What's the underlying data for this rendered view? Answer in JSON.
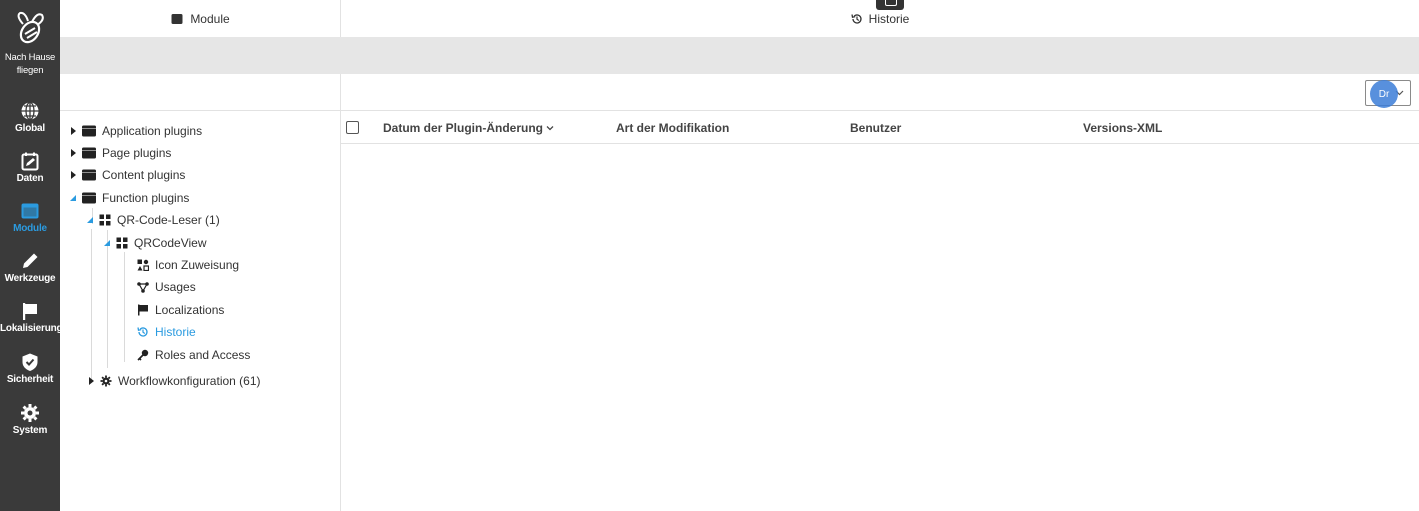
{
  "nav": {
    "home_label_line1": "Nach Hause",
    "home_label_line2": "fliegen",
    "items": [
      {
        "label": "Global",
        "icon": "globe-icon"
      },
      {
        "label": "Daten",
        "icon": "calendar-edit-icon"
      },
      {
        "label": "Module",
        "icon": "module-icon",
        "active": true
      },
      {
        "label": "Werkzeuge",
        "icon": "pencil-icon"
      },
      {
        "label": "Lokalisierung",
        "icon": "flag-icon"
      },
      {
        "label": "Sicherheit",
        "icon": "shield-check-icon"
      },
      {
        "label": "System",
        "icon": "gear-icon"
      }
    ],
    "active_color": "#2b9be0",
    "background": "#3a3a3a"
  },
  "left_panel": {
    "title": "Module",
    "tree": [
      {
        "label": "Application plugins",
        "expanded": false
      },
      {
        "label": "Page plugins",
        "expanded": false
      },
      {
        "label": "Content plugins",
        "expanded": false
      },
      {
        "label": "Function plugins",
        "expanded": true
      },
      {
        "label": "QR-Code-Leser (1)",
        "expanded": true
      },
      {
        "label": "QRCodeView",
        "expanded": true
      },
      {
        "label": "Icon Zuweisung"
      },
      {
        "label": "Usages"
      },
      {
        "label": "Localizations"
      },
      {
        "label": "Historie",
        "selected": true
      },
      {
        "label": "Roles and Access"
      },
      {
        "label": "Workflowkonfiguration (61)",
        "expanded": false
      }
    ]
  },
  "right_panel": {
    "title": "Historie",
    "column_chooser_label": "Dr",
    "columns": [
      {
        "label": "Datum der Plugin-Änderung",
        "sorted": "desc"
      },
      {
        "label": "Art der Modifikation"
      },
      {
        "label": "Benutzer"
      },
      {
        "label": "Versions-XML"
      }
    ]
  }
}
